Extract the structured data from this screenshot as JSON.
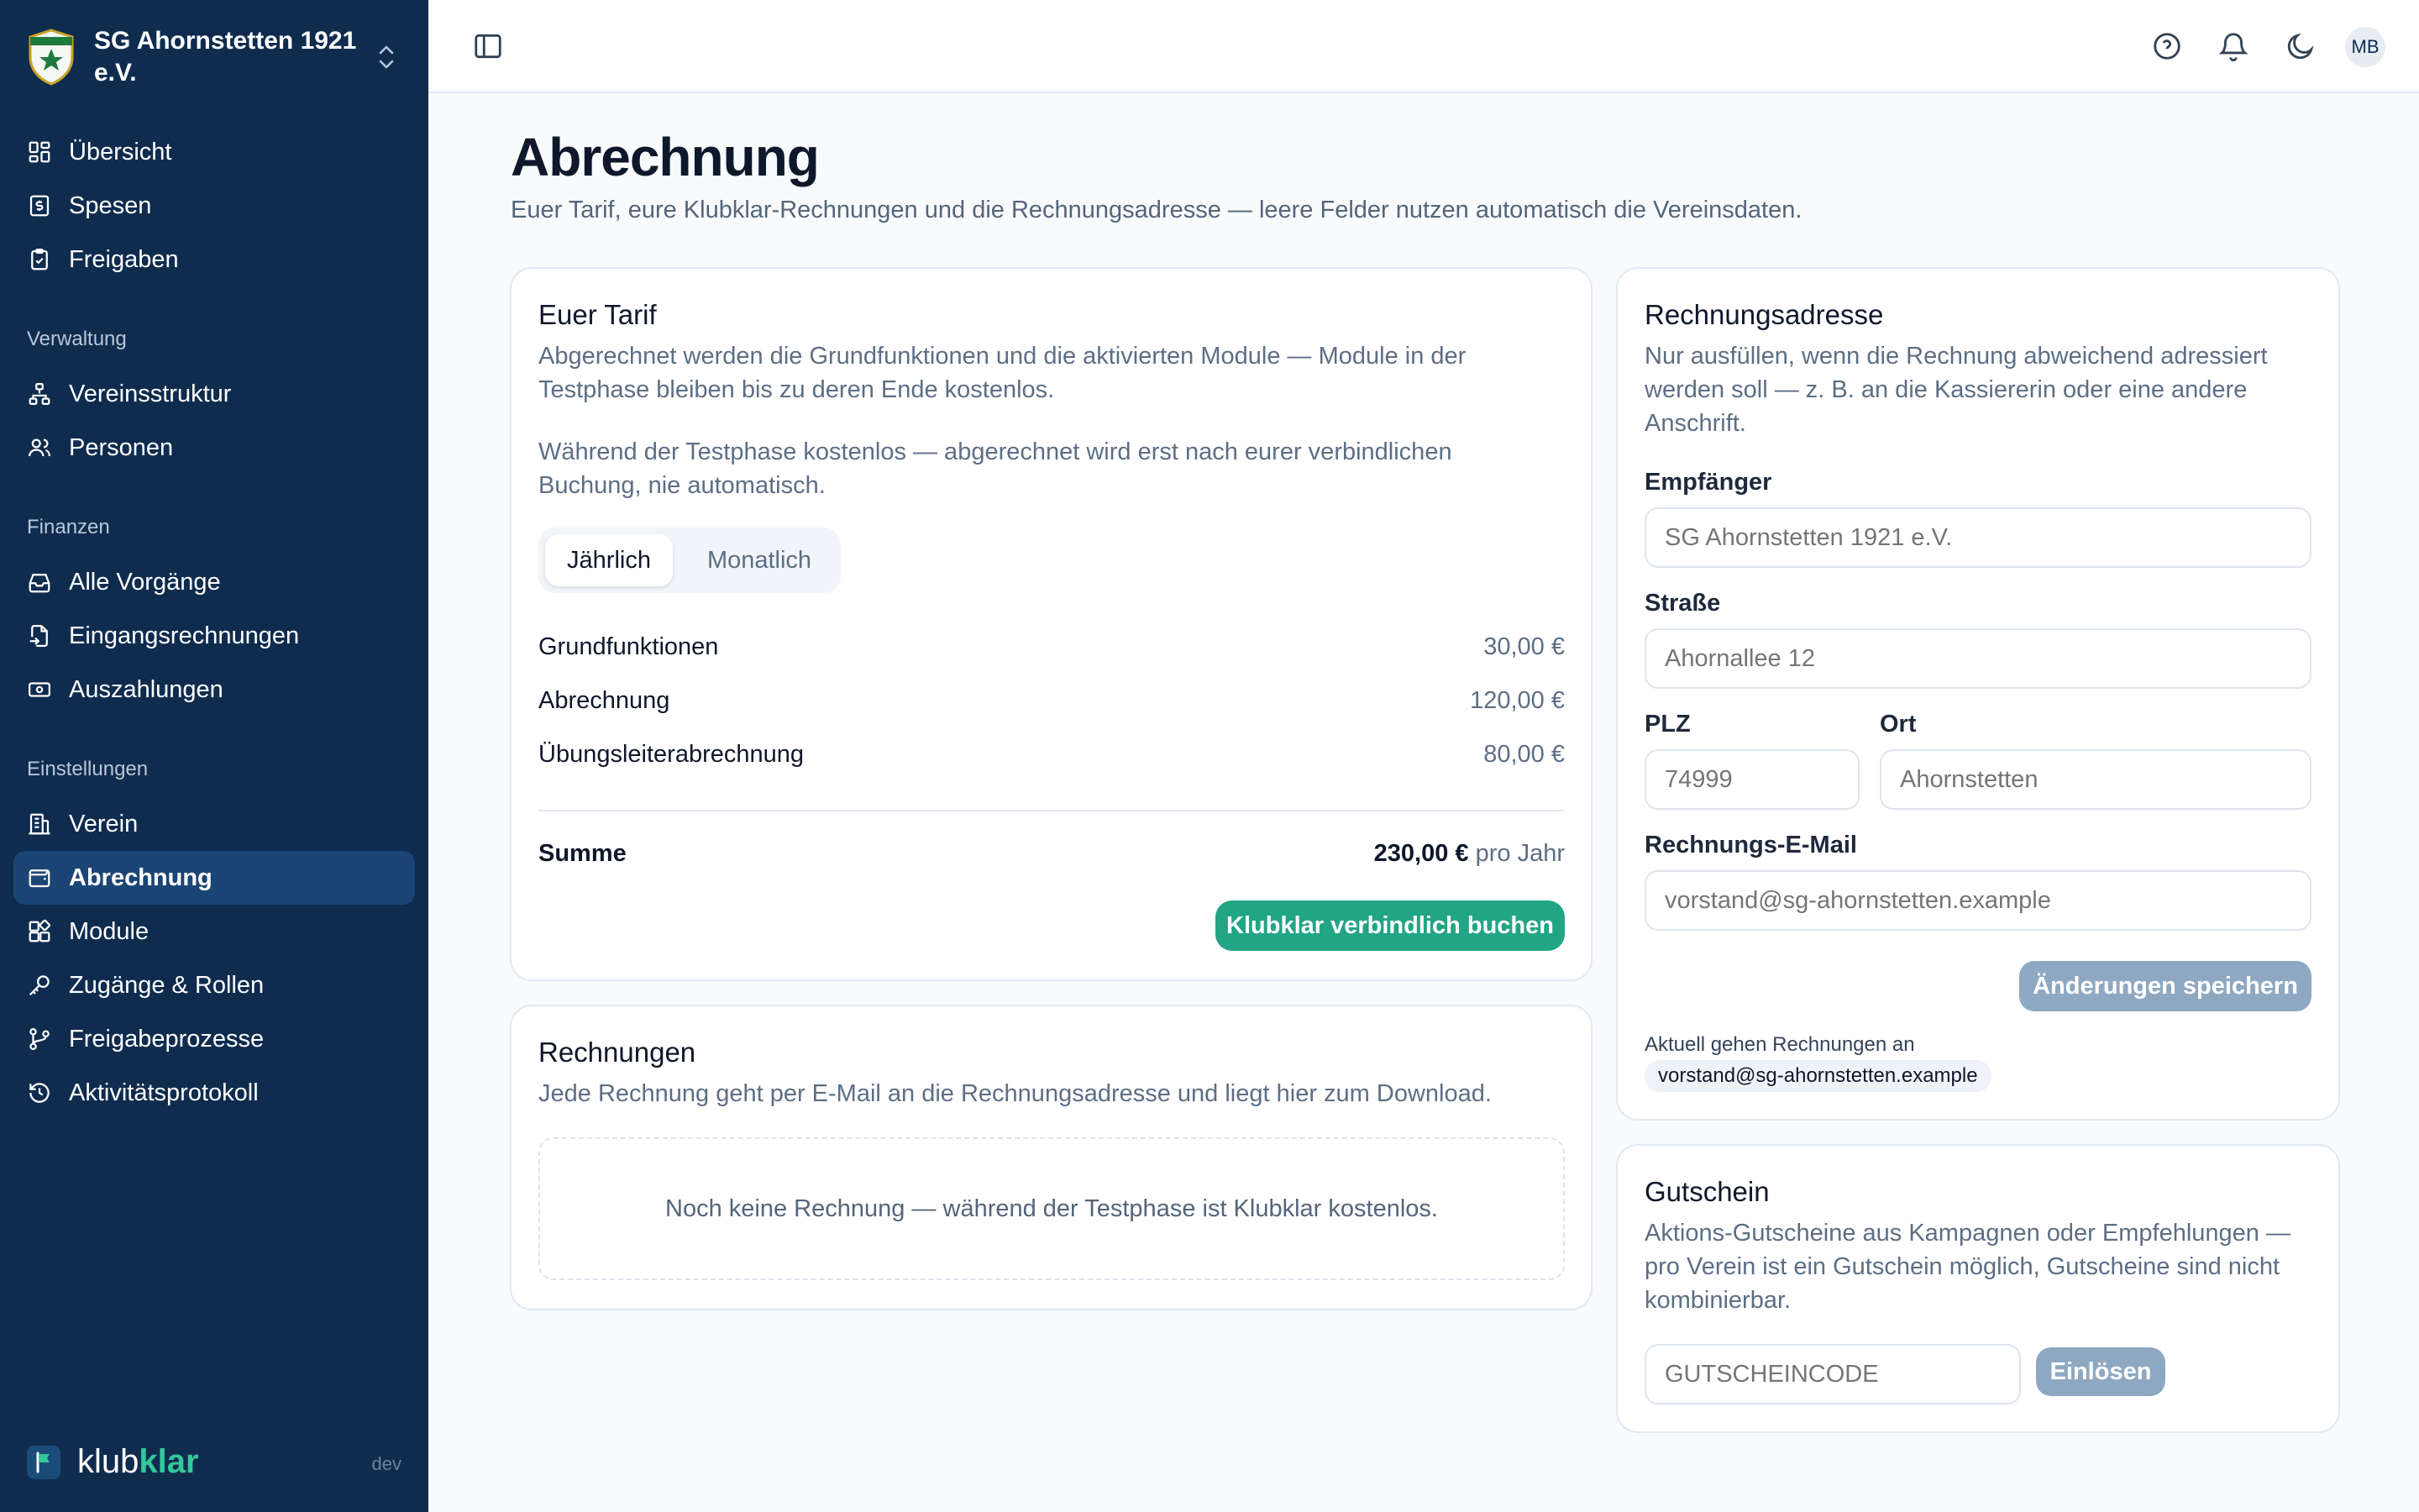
{
  "club": {
    "name": "SG Ahornstetten 1921 e.V."
  },
  "nav": {
    "primary": [
      "Übersicht",
      "Spesen",
      "Freigaben"
    ],
    "sections": {
      "verwaltung": "Verwaltung",
      "finanzen": "Finanzen",
      "einstellungen": "Einstellungen"
    },
    "verwaltung": [
      "Vereinsstruktur",
      "Personen"
    ],
    "finanzen": [
      "Alle Vorgänge",
      "Eingangsrechnungen",
      "Auszahlungen"
    ],
    "einstellungen": [
      "Verein",
      "Abrechnung",
      "Module",
      "Zugänge & Rollen",
      "Freigabeprozesse",
      "Aktivitätsprotokoll"
    ],
    "active": "Abrechnung"
  },
  "brand": {
    "part1": "klub",
    "part2": "klar",
    "env": "dev",
    "accent": "#34c79a"
  },
  "topbar": {
    "avatar": "MB",
    "icons": [
      "sidebar-toggle-icon",
      "help-icon",
      "bell-icon",
      "moon-icon"
    ]
  },
  "page": {
    "title": "Abrechnung",
    "subtitle": "Euer Tarif, eure Klubklar-Rechnungen und die Rechnungsadresse — leere Felder nutzen automatisch die Vereinsdaten."
  },
  "tarif": {
    "title": "Euer Tarif",
    "desc": "Abgerechnet werden die Grundfunktionen und die aktivierten Module — Module in der Testphase bleiben bis zu deren Ende kostenlos.",
    "trial_note": "Während der Testphase kostenlos — abgerechnet wird erst nach eurer verbindlichen Buchung, nie automatisch.",
    "billing_options": [
      "Jährlich",
      "Monatlich"
    ],
    "selected_billing": "Jährlich",
    "items": [
      {
        "label": "Grundfunktionen",
        "price": "30,00 €"
      },
      {
        "label": "Abrechnung",
        "price": "120,00 €"
      },
      {
        "label": "Übungsleiterabrechnung",
        "price": "80,00 €"
      }
    ],
    "sum_label": "Summe",
    "sum_value": "230,00 €",
    "sum_period": "pro Jahr",
    "book_button": "Klubklar verbindlich buchen",
    "accent": "#22a584"
  },
  "rechnungen": {
    "title": "Rechnungen",
    "desc": "Jede Rechnung geht per E-Mail an die Rechnungsadresse und liegt hier zum Download.",
    "empty": "Noch keine Rechnung — während der Testphase ist Klubklar kostenlos."
  },
  "adresse": {
    "title": "Rechnungsadresse",
    "desc": "Nur ausfüllen, wenn die Rechnung abweichend adressiert werden soll — z. B. an die Kassiererin oder eine andere Anschrift.",
    "fields": {
      "empfaenger": {
        "label": "Empfänger",
        "placeholder": "SG Ahornstetten 1921 e.V."
      },
      "strasse": {
        "label": "Straße",
        "placeholder": "Ahornallee 12"
      },
      "plz": {
        "label": "PLZ",
        "placeholder": "74999"
      },
      "ort": {
        "label": "Ort",
        "placeholder": "Ahornstetten"
      },
      "email": {
        "label": "Rechnungs-E-Mail",
        "placeholder": "vorstand@sg-ahornstetten.example"
      }
    },
    "save_button": "Änderungen speichern",
    "current_label": "Aktuell gehen Rechnungen an",
    "current_value": "vorstand@sg-ahornstetten.example"
  },
  "gutschein": {
    "title": "Gutschein",
    "desc": "Aktions-Gutscheine aus Kampagnen oder Empfehlungen — pro Verein ist ein Gutschein möglich, Gutscheine sind nicht kombinierbar.",
    "placeholder": "GUTSCHEINCODE",
    "redeem_button": "Einlösen"
  }
}
